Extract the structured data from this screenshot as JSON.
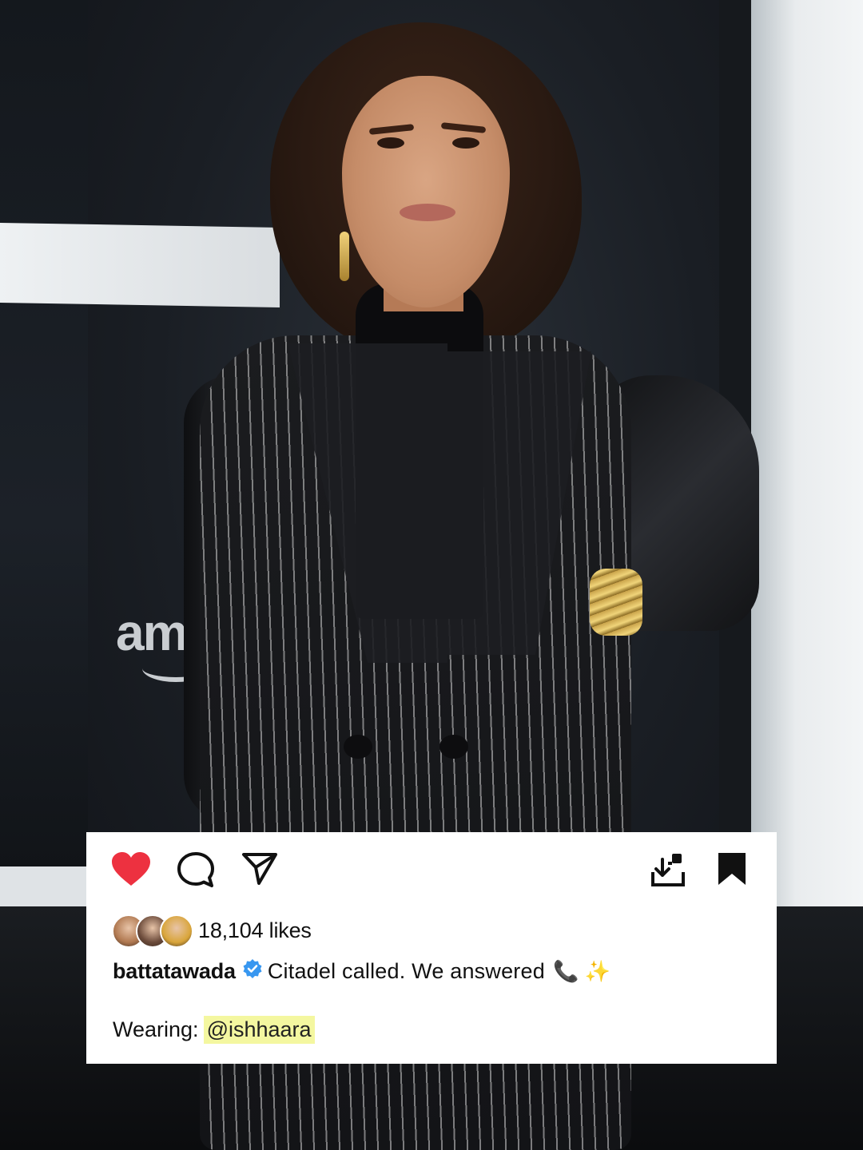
{
  "background": {
    "brand_mark": "am"
  },
  "post": {
    "actions": {
      "like_icon": "heart-filled-icon",
      "comment_icon": "comment-bubble-icon",
      "share_icon": "paper-plane-icon",
      "download_icon": "download-icon",
      "save_icon": "bookmark-filled-icon",
      "like_color": "#ed3140"
    },
    "likes": {
      "count_label": "18,104 likes",
      "avatar_colors": [
        "#b07850",
        "#6b4a3a",
        "#d9a53a"
      ]
    },
    "caption": {
      "username": "battatawada",
      "verified_color": "#3897f0",
      "text": "Citadel called. We answered",
      "emoji": "📞 ✨"
    },
    "wearing": {
      "label": "Wearing:",
      "mention_glyph": "@",
      "mention_handle": "ishhaara",
      "highlight_color": "#f4f7a0"
    }
  }
}
